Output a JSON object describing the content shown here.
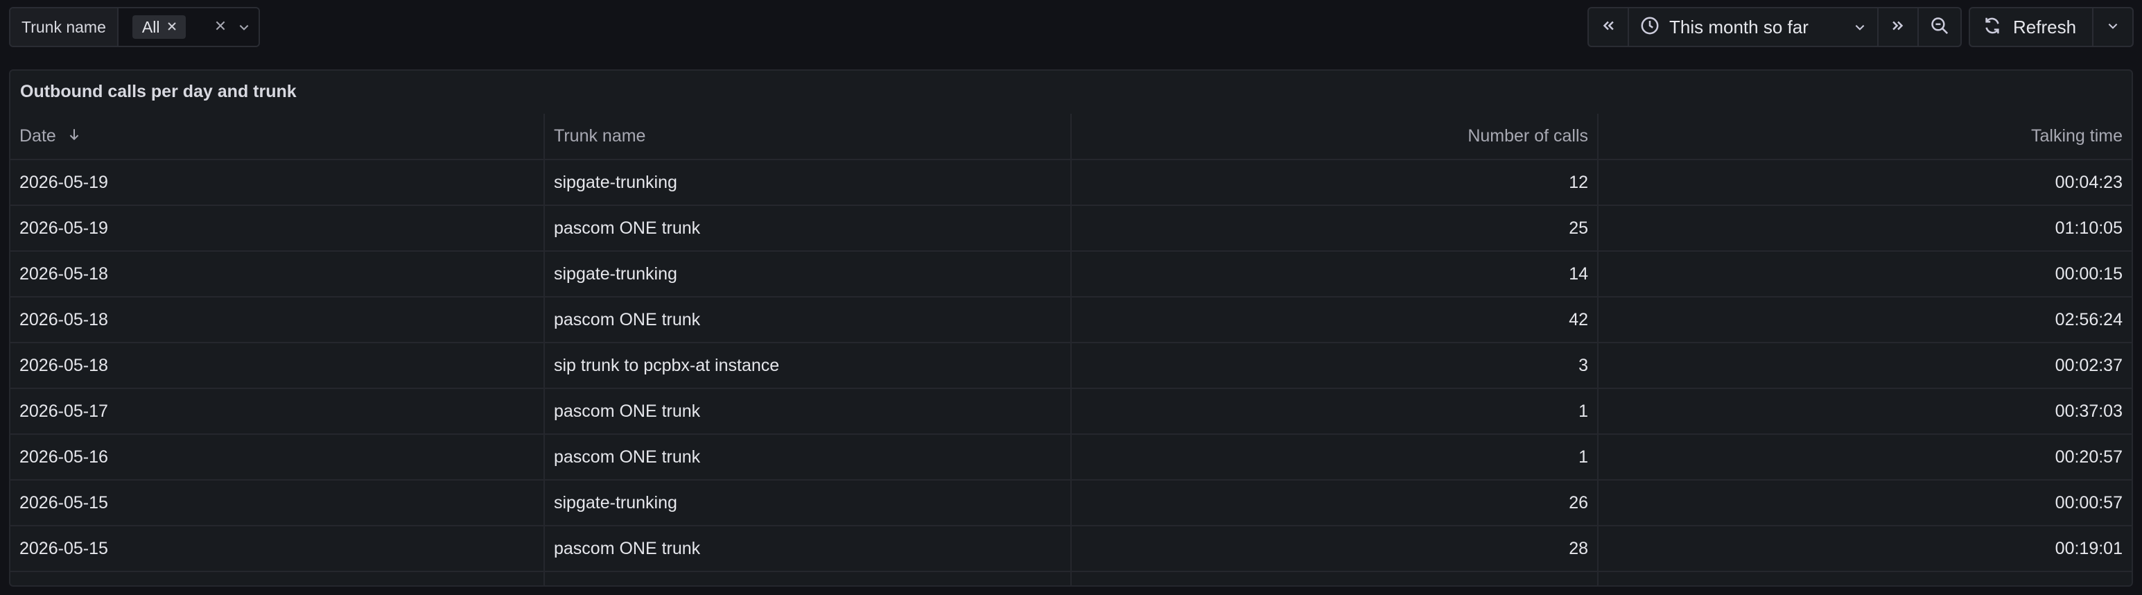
{
  "filter": {
    "label": "Trunk name",
    "selected_chip": "All",
    "chip_remove_icon": "close-icon",
    "clear_icon": "close-icon",
    "dropdown_icon": "chevron-down-icon"
  },
  "time_picker": {
    "shift_back_icon": "double-chevron-left-icon",
    "clock_icon": "clock-icon",
    "range_label": "This month so far",
    "range_dropdown_icon": "chevron-down-icon",
    "shift_forward_icon": "double-chevron-right-icon",
    "zoom_out_icon": "zoom-out-icon"
  },
  "refresh": {
    "label": "Refresh",
    "icon": "refresh-icon",
    "dropdown_icon": "chevron-down-icon"
  },
  "panel": {
    "title": "Outbound calls per day and trunk",
    "columns": [
      "Date",
      "Trunk name",
      "Number of calls",
      "Talking time"
    ],
    "sort_icon": "arrow-down-icon",
    "rows": [
      [
        "2026-05-19",
        "sipgate-trunking",
        "12",
        "00:04:23"
      ],
      [
        "2026-05-19",
        "pascom ONE trunk",
        "25",
        "01:10:05"
      ],
      [
        "2026-05-18",
        "sipgate-trunking",
        "14",
        "00:00:15"
      ],
      [
        "2026-05-18",
        "pascom ONE trunk",
        "42",
        "02:56:24"
      ],
      [
        "2026-05-18",
        "sip trunk to pcpbx-at instance",
        "3",
        "00:02:37"
      ],
      [
        "2026-05-17",
        "pascom ONE trunk",
        "1",
        "00:37:03"
      ],
      [
        "2026-05-16",
        "pascom ONE trunk",
        "1",
        "00:20:57"
      ],
      [
        "2026-05-15",
        "sipgate-trunking",
        "26",
        "00:00:57"
      ],
      [
        "2026-05-15",
        "pascom ONE trunk",
        "28",
        "00:19:01"
      ]
    ]
  },
  "colors": {
    "background": "#111217",
    "panel": "#181b1f",
    "border": "#25272d",
    "text": "#e6e7ec",
    "muted_text": "#a8a9b3"
  }
}
